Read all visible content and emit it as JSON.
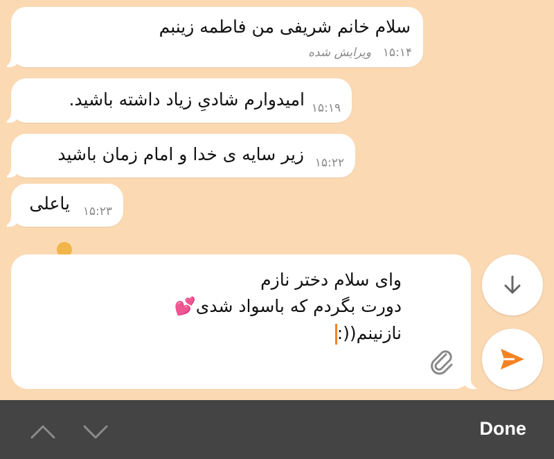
{
  "messages": [
    {
      "text": "سلام خانم شریفی من فاطمه زینبم",
      "time": "۱۵:۱۴",
      "edited": "ویرایش شده"
    },
    {
      "text": "امیدوارم شادیِ زیاد داشته باشید.",
      "time": "۱۵:۱۹"
    },
    {
      "text": "زیر سایه ی خدا و امام زمان باشید",
      "time": "۱۵:۲۲"
    },
    {
      "text": "یاعلی",
      "time": "۱۵:۲۳"
    }
  ],
  "composer": {
    "lines": [
      "وای سلام دختر نازم",
      "دورت بگردم که باسواد شدی💕",
      "نازنینم((:"
    ]
  },
  "icons": {
    "attach": "paperclip-icon",
    "send": "send-icon",
    "scroll_down": "arrow-down-icon",
    "prev": "chevron-up-icon",
    "next": "chevron-down-icon"
  },
  "colors": {
    "background": "#fbd9b3",
    "accent": "#f58220",
    "toolbar": "#444444"
  },
  "toolbar": {
    "done_label": "Done"
  }
}
